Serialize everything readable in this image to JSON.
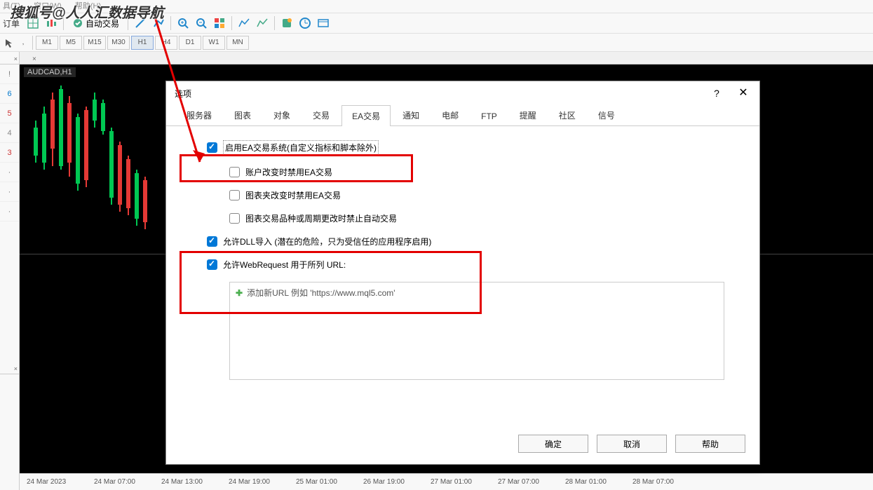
{
  "watermark": "搜狐号@人人汇数据导航",
  "menubar": {
    "tools": "具(T)",
    "window": "窗口(W)",
    "help": "帮助(H)"
  },
  "toolbar": {
    "order": "订单",
    "autotrade": "自动交易"
  },
  "timeframes": [
    "M1",
    "M5",
    "M15",
    "M30",
    "H1",
    "H4",
    "D1",
    "W1",
    "MN"
  ],
  "active_tf": "H1",
  "side_nums": [
    "!",
    "6",
    "5",
    "4",
    "3",
    "·",
    "·",
    "·"
  ],
  "chart": {
    "label": "AUDCAD,H1",
    "times": [
      "24 Mar 2023",
      "24 Mar 07:00",
      "24 Mar 13:00",
      "24 Mar 19:00",
      "25 Mar 01:00",
      "26 Mar 19:00",
      "27 Mar 01:00",
      "27 Mar 07:00",
      "28 Mar 01:00",
      "28 Mar 07:00"
    ]
  },
  "dialog": {
    "title": "选项",
    "tabs": [
      "服务器",
      "图表",
      "对象",
      "交易",
      "EA交易",
      "通知",
      "电邮",
      "FTP",
      "提醒",
      "社区",
      "信号"
    ],
    "active_tab": 4,
    "chk1": "启用EA交易系统(自定义指标和脚本除外)",
    "chk2": "账户改变时禁用EA交易",
    "chk3": "图表夹改变时禁用EA交易",
    "chk4": "图表交易品种或周期更改时禁止自动交易",
    "chk5": "允许DLL导入 (潜在的危险，只为受信任的应用程序启用)",
    "chk6": "允许WebRequest 用于所列 URL:",
    "url_hint": "添加新URL 例如 'https://www.mql5.com'",
    "ok": "确定",
    "cancel": "取消",
    "help": "帮助"
  }
}
